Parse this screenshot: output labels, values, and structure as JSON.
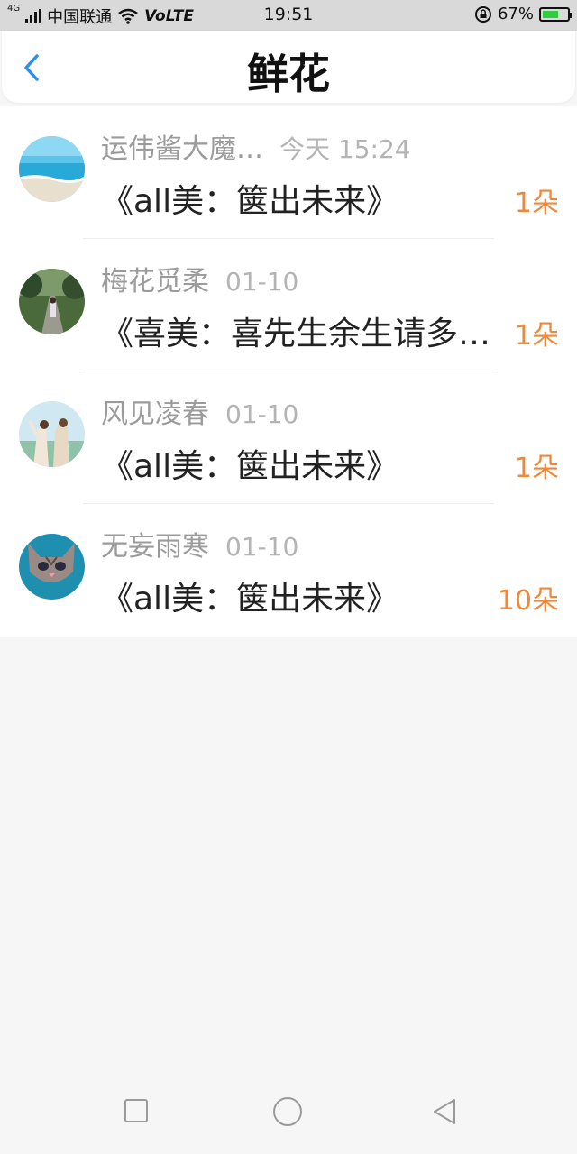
{
  "status_bar": {
    "network_label": "4G",
    "carrier": "中国联通",
    "volte": "VoLTE",
    "time": "19:51",
    "battery_percent": "67%",
    "battery_level": 0.67
  },
  "header": {
    "title": "鲜花",
    "back_icon": "chevron-left-icon"
  },
  "rows": [
    {
      "name": "运伟酱大魔…",
      "date": "今天 15:24",
      "book": "《all美：箧出未来》",
      "count": "1朵"
    },
    {
      "name": "梅花觅柔",
      "date": "01-10",
      "book": "《喜美：喜先生余生请多指教》",
      "count": "1朵"
    },
    {
      "name": "风见凌春",
      "date": "01-10",
      "book": "《all美：箧出未来》",
      "count": "1朵"
    },
    {
      "name": "无妄雨寒",
      "date": "01-10",
      "book": "《all美：箧出未来》",
      "count": "10朵"
    }
  ],
  "colors": {
    "accent_blue": "#2b8ff0",
    "count_orange": "#f0883a",
    "battery_green": "#2ecc40"
  },
  "navbar": {
    "icons": [
      "square-recent-icon",
      "circle-home-icon",
      "triangle-back-icon"
    ]
  }
}
